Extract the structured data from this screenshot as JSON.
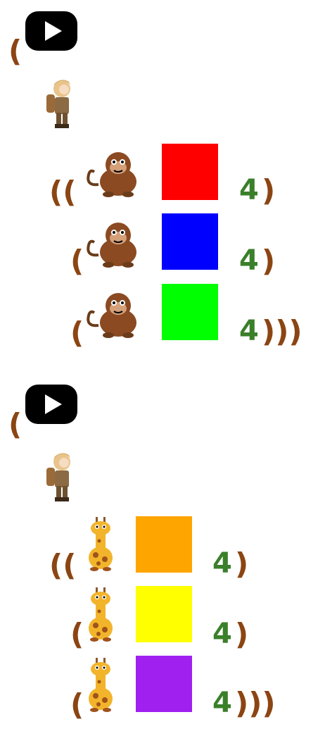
{
  "blocks": [
    {
      "id": "monkeys",
      "open_paren": "(",
      "play_icon": "play-button-icon",
      "explorer_icon": "explorer-character-icon",
      "rows": [
        {
          "open": "((",
          "animal": "monkey-icon",
          "color": "#ff0000",
          "value": "4",
          "close": ")"
        },
        {
          "open": "(",
          "animal": "monkey-icon",
          "color": "#0000ff",
          "value": "4",
          "close": ")"
        },
        {
          "open": "(",
          "animal": "monkey-icon",
          "color": "#00ff00",
          "value": "4",
          "close": ")))"
        }
      ]
    },
    {
      "id": "giraffes",
      "open_paren": "(",
      "play_icon": "play-button-icon",
      "explorer_icon": "explorer-character-icon",
      "rows": [
        {
          "open": "((",
          "animal": "giraffe-icon",
          "color": "#ffa500",
          "value": "4",
          "close": ")"
        },
        {
          "open": "(",
          "animal": "giraffe-icon",
          "color": "#ffff00",
          "value": "4",
          "close": ")"
        },
        {
          "open": "(",
          "animal": "giraffe-icon",
          "color": "#a020f0",
          "value": "4",
          "close": ")))"
        }
      ]
    }
  ]
}
